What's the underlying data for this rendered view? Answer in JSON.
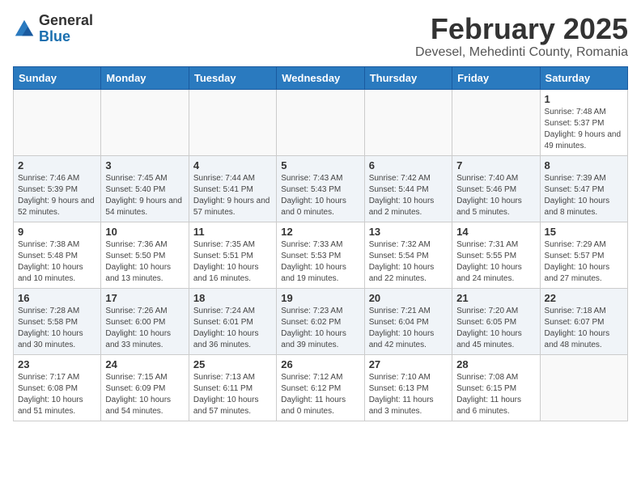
{
  "logo": {
    "general": "General",
    "blue": "Blue"
  },
  "header": {
    "month": "February 2025",
    "location": "Devesel, Mehedinti County, Romania"
  },
  "weekdays": [
    "Sunday",
    "Monday",
    "Tuesday",
    "Wednesday",
    "Thursday",
    "Friday",
    "Saturday"
  ],
  "weeks": [
    [
      {
        "day": "",
        "info": ""
      },
      {
        "day": "",
        "info": ""
      },
      {
        "day": "",
        "info": ""
      },
      {
        "day": "",
        "info": ""
      },
      {
        "day": "",
        "info": ""
      },
      {
        "day": "",
        "info": ""
      },
      {
        "day": "1",
        "info": "Sunrise: 7:48 AM\nSunset: 5:37 PM\nDaylight: 9 hours and 49 minutes."
      }
    ],
    [
      {
        "day": "2",
        "info": "Sunrise: 7:46 AM\nSunset: 5:39 PM\nDaylight: 9 hours and 52 minutes."
      },
      {
        "day": "3",
        "info": "Sunrise: 7:45 AM\nSunset: 5:40 PM\nDaylight: 9 hours and 54 minutes."
      },
      {
        "day": "4",
        "info": "Sunrise: 7:44 AM\nSunset: 5:41 PM\nDaylight: 9 hours and 57 minutes."
      },
      {
        "day": "5",
        "info": "Sunrise: 7:43 AM\nSunset: 5:43 PM\nDaylight: 10 hours and 0 minutes."
      },
      {
        "day": "6",
        "info": "Sunrise: 7:42 AM\nSunset: 5:44 PM\nDaylight: 10 hours and 2 minutes."
      },
      {
        "day": "7",
        "info": "Sunrise: 7:40 AM\nSunset: 5:46 PM\nDaylight: 10 hours and 5 minutes."
      },
      {
        "day": "8",
        "info": "Sunrise: 7:39 AM\nSunset: 5:47 PM\nDaylight: 10 hours and 8 minutes."
      }
    ],
    [
      {
        "day": "9",
        "info": "Sunrise: 7:38 AM\nSunset: 5:48 PM\nDaylight: 10 hours and 10 minutes."
      },
      {
        "day": "10",
        "info": "Sunrise: 7:36 AM\nSunset: 5:50 PM\nDaylight: 10 hours and 13 minutes."
      },
      {
        "day": "11",
        "info": "Sunrise: 7:35 AM\nSunset: 5:51 PM\nDaylight: 10 hours and 16 minutes."
      },
      {
        "day": "12",
        "info": "Sunrise: 7:33 AM\nSunset: 5:53 PM\nDaylight: 10 hours and 19 minutes."
      },
      {
        "day": "13",
        "info": "Sunrise: 7:32 AM\nSunset: 5:54 PM\nDaylight: 10 hours and 22 minutes."
      },
      {
        "day": "14",
        "info": "Sunrise: 7:31 AM\nSunset: 5:55 PM\nDaylight: 10 hours and 24 minutes."
      },
      {
        "day": "15",
        "info": "Sunrise: 7:29 AM\nSunset: 5:57 PM\nDaylight: 10 hours and 27 minutes."
      }
    ],
    [
      {
        "day": "16",
        "info": "Sunrise: 7:28 AM\nSunset: 5:58 PM\nDaylight: 10 hours and 30 minutes."
      },
      {
        "day": "17",
        "info": "Sunrise: 7:26 AM\nSunset: 6:00 PM\nDaylight: 10 hours and 33 minutes."
      },
      {
        "day": "18",
        "info": "Sunrise: 7:24 AM\nSunset: 6:01 PM\nDaylight: 10 hours and 36 minutes."
      },
      {
        "day": "19",
        "info": "Sunrise: 7:23 AM\nSunset: 6:02 PM\nDaylight: 10 hours and 39 minutes."
      },
      {
        "day": "20",
        "info": "Sunrise: 7:21 AM\nSunset: 6:04 PM\nDaylight: 10 hours and 42 minutes."
      },
      {
        "day": "21",
        "info": "Sunrise: 7:20 AM\nSunset: 6:05 PM\nDaylight: 10 hours and 45 minutes."
      },
      {
        "day": "22",
        "info": "Sunrise: 7:18 AM\nSunset: 6:07 PM\nDaylight: 10 hours and 48 minutes."
      }
    ],
    [
      {
        "day": "23",
        "info": "Sunrise: 7:17 AM\nSunset: 6:08 PM\nDaylight: 10 hours and 51 minutes."
      },
      {
        "day": "24",
        "info": "Sunrise: 7:15 AM\nSunset: 6:09 PM\nDaylight: 10 hours and 54 minutes."
      },
      {
        "day": "25",
        "info": "Sunrise: 7:13 AM\nSunset: 6:11 PM\nDaylight: 10 hours and 57 minutes."
      },
      {
        "day": "26",
        "info": "Sunrise: 7:12 AM\nSunset: 6:12 PM\nDaylight: 11 hours and 0 minutes."
      },
      {
        "day": "27",
        "info": "Sunrise: 7:10 AM\nSunset: 6:13 PM\nDaylight: 11 hours and 3 minutes."
      },
      {
        "day": "28",
        "info": "Sunrise: 7:08 AM\nSunset: 6:15 PM\nDaylight: 11 hours and 6 minutes."
      },
      {
        "day": "",
        "info": ""
      }
    ]
  ]
}
